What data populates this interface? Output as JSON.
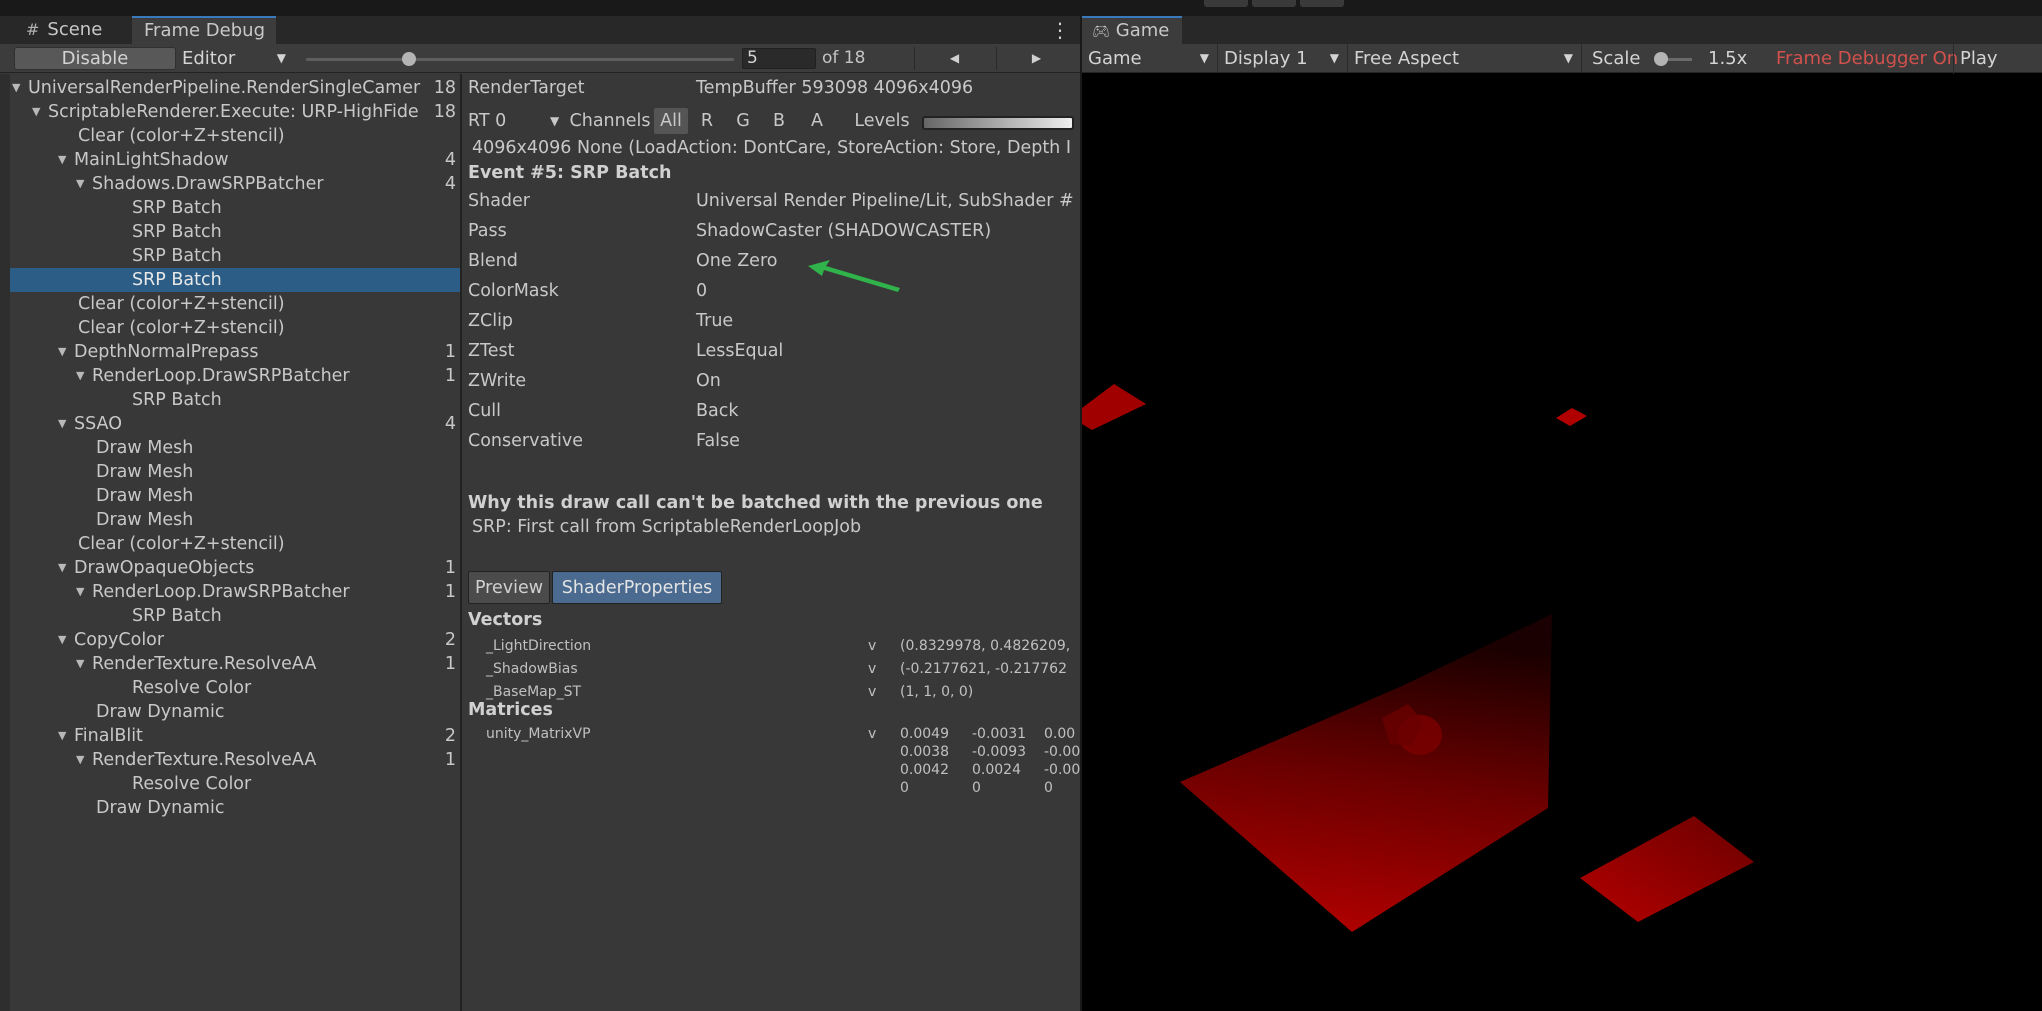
{
  "left_tabs": {
    "scene_label": "Scene",
    "frame_debug_label": "Frame Debug"
  },
  "toolbar": {
    "disable_label": "Disable",
    "editor_label": "Editor",
    "frame_value": "5",
    "of_label": "of 18",
    "slider_fraction": 0.24
  },
  "tree": [
    {
      "label": "UniversalRenderPipeline.RenderSingleCamer",
      "count": "18",
      "depth": 0,
      "expanded": true
    },
    {
      "label": "ScriptableRenderer.Execute: URP-HighFide",
      "count": "18",
      "depth": 1,
      "expanded": true
    },
    {
      "label": "Clear (color+Z+stencil)",
      "count": "",
      "depth": 2
    },
    {
      "label": "MainLightShadow",
      "count": "4",
      "depth": 2,
      "expanded": true
    },
    {
      "label": "Shadows.DrawSRPBatcher",
      "count": "4",
      "depth": 3,
      "expanded": true
    },
    {
      "label": "SRP Batch",
      "count": "",
      "depth": 4
    },
    {
      "label": "SRP Batch",
      "count": "",
      "depth": 4
    },
    {
      "label": "SRP Batch",
      "count": "",
      "depth": 4
    },
    {
      "label": "SRP Batch",
      "count": "",
      "depth": 4,
      "selected": true
    },
    {
      "label": "Clear (color+Z+stencil)",
      "count": "",
      "depth": 2
    },
    {
      "label": "Clear (color+Z+stencil)",
      "count": "",
      "depth": 2
    },
    {
      "label": "DepthNormalPrepass",
      "count": "1",
      "depth": 2,
      "expanded": true
    },
    {
      "label": "RenderLoop.DrawSRPBatcher",
      "count": "1",
      "depth": 3,
      "expanded": true
    },
    {
      "label": "SRP Batch",
      "count": "",
      "depth": 4
    },
    {
      "label": "SSAO",
      "count": "4",
      "depth": 2,
      "expanded": true
    },
    {
      "label": "Draw Mesh",
      "count": "",
      "depth": 3
    },
    {
      "label": "Draw Mesh",
      "count": "",
      "depth": 3
    },
    {
      "label": "Draw Mesh",
      "count": "",
      "depth": 3
    },
    {
      "label": "Draw Mesh",
      "count": "",
      "depth": 3
    },
    {
      "label": "Clear (color+Z+stencil)",
      "count": "",
      "depth": 2
    },
    {
      "label": "DrawOpaqueObjects",
      "count": "1",
      "depth": 2,
      "expanded": true
    },
    {
      "label": "RenderLoop.DrawSRPBatcher",
      "count": "1",
      "depth": 3,
      "expanded": true
    },
    {
      "label": "SRP Batch",
      "count": "",
      "depth": 4
    },
    {
      "label": "CopyColor",
      "count": "2",
      "depth": 2,
      "expanded": true
    },
    {
      "label": "RenderTexture.ResolveAA",
      "count": "1",
      "depth": 3,
      "expanded": true
    },
    {
      "label": "Resolve Color",
      "count": "",
      "depth": 4
    },
    {
      "label": "Draw Dynamic",
      "count": "",
      "depth": 3
    },
    {
      "label": "FinalBlit",
      "count": "2",
      "depth": 2,
      "expanded": true
    },
    {
      "label": "RenderTexture.ResolveAA",
      "count": "1",
      "depth": 3,
      "expanded": true
    },
    {
      "label": "Resolve Color",
      "count": "",
      "depth": 4
    },
    {
      "label": "Draw Dynamic",
      "count": "",
      "depth": 3
    }
  ],
  "details": {
    "render_target_label": "RenderTarget",
    "render_target_value": "TempBuffer 593098 4096x4096",
    "rt_dropdown": "RT 0",
    "channels_label": "Channels",
    "channels": [
      "All",
      "R",
      "G",
      "B",
      "A"
    ],
    "levels_label": "Levels",
    "load_info": "4096x4096 None (LoadAction: DontCare, StoreAction: Store, Depth I",
    "event_title": "Event #5: SRP Batch",
    "props": [
      {
        "name": "Shader",
        "value": "Universal Render Pipeline/Lit, SubShader #"
      },
      {
        "name": "Pass",
        "value": "ShadowCaster (SHADOWCASTER)"
      },
      {
        "name": "Blend",
        "value": "One Zero"
      },
      {
        "name": "ColorMask",
        "value": "0"
      },
      {
        "name": "ZClip",
        "value": "True"
      },
      {
        "name": "ZTest",
        "value": "LessEqual"
      },
      {
        "name": "ZWrite",
        "value": "On"
      },
      {
        "name": "Cull",
        "value": "Back"
      },
      {
        "name": "Conservative",
        "value": "False"
      }
    ],
    "why_title": "Why this draw call can't be batched with the previous one",
    "why_reason": "SRP: First call from ScriptableRenderLoopJob",
    "preview_tab": "Preview",
    "shaderprops_tab": "ShaderProperties",
    "vectors_heading": "Vectors",
    "vectors": [
      {
        "name": "_LightDirection",
        "stage": "v",
        "value": "(0.8329978, 0.4826209,"
      },
      {
        "name": "_ShadowBias",
        "stage": "v",
        "value": "(-0.2177621, -0.217762"
      },
      {
        "name": "_BaseMap_ST",
        "stage": "v",
        "value": "(1, 1, 0, 0)"
      }
    ],
    "matrices_heading": "Matrices",
    "matrix": {
      "name": "unity_MatrixVP",
      "stage": "v",
      "rows": [
        [
          "0.0049",
          "-0.0031",
          "0.00"
        ],
        [
          "0.0038",
          "-0.0093",
          "-0.00"
        ],
        [
          "0.0042",
          "0.0024",
          "-0.00"
        ],
        [
          "0",
          "0",
          "0"
        ]
      ]
    }
  },
  "game": {
    "tab_label": "Game",
    "mode_label": "Game",
    "display_label": "Display 1",
    "aspect_label": "Free Aspect",
    "scale_label": "Scale",
    "scale_value": "1.5x",
    "frame_debugger_label": "Frame Debugger On",
    "play_focus_label": "Play Focu",
    "frame_debugger_color": "#d2514d"
  },
  "colors": {
    "selection": "#2c5d87",
    "annotation_arrow": "#2fb34a",
    "active_tab_button": "#4a6a8f"
  }
}
